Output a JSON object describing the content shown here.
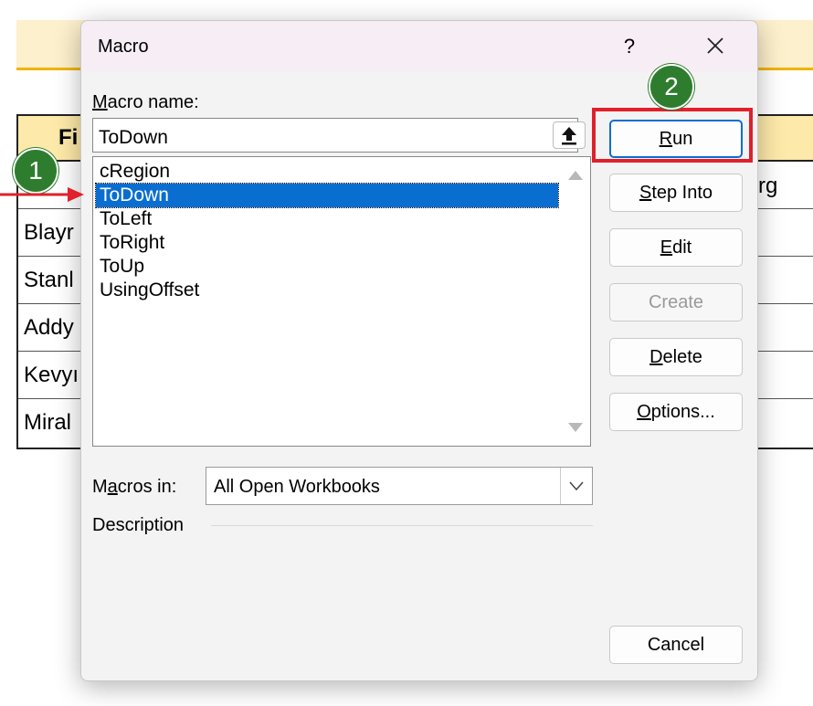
{
  "spreadsheet": {
    "header_partial": "Fi",
    "right_partial": ".org",
    "rows": [
      "Blayr",
      "Stanl",
      "Addy",
      "Kevyı",
      "Miral"
    ]
  },
  "annotations": {
    "marker1": "1",
    "marker2": "2",
    "arrow_color": "#e0202b",
    "highlight_color": "#e0202b",
    "marker_color": "#2e7d2e"
  },
  "dialog": {
    "title": "Macro",
    "help": "?",
    "macro_name_label_mnemonic": "M",
    "macro_name_label_rest": "acro name:",
    "macro_name_value": "ToDown",
    "macros": [
      {
        "label": "cRegion",
        "selected": false
      },
      {
        "label": "ToDown",
        "selected": true
      },
      {
        "label": "ToLeft",
        "selected": false
      },
      {
        "label": "ToRight",
        "selected": false
      },
      {
        "label": "ToUp",
        "selected": false
      },
      {
        "label": "UsingOffset",
        "selected": false
      }
    ],
    "macros_in_label_pre": "M",
    "macros_in_label_mnemonic": "a",
    "macros_in_label_post": "cros in:",
    "macros_in_value": "All Open Workbooks",
    "description_label": "Description",
    "buttons": {
      "run_mnemonic": "R",
      "run_rest": "un",
      "step_into_mnemonic": "S",
      "step_into_rest": "tep Into",
      "edit_mnemonic": "E",
      "edit_rest": "dit",
      "create": "Create",
      "delete_mnemonic": "D",
      "delete_rest": "elete",
      "options_mnemonic": "O",
      "options_rest": "ptions...",
      "cancel": "Cancel"
    },
    "accent_color": "#0a6ed1"
  }
}
